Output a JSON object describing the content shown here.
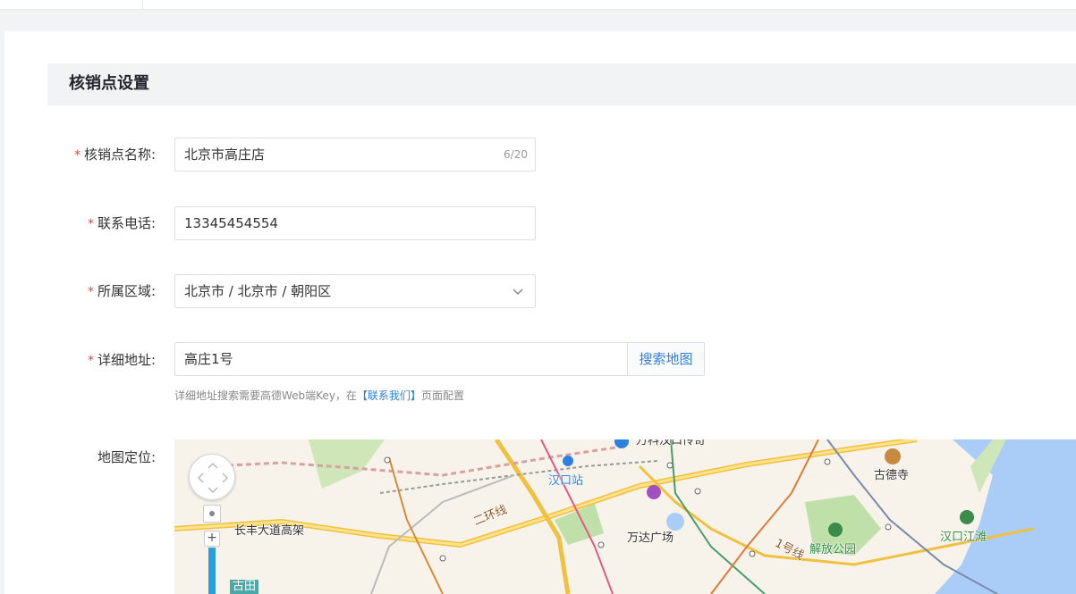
{
  "section": {
    "title": "核销点设置"
  },
  "form": {
    "required_mark": "*",
    "name": {
      "label": "核销点名称:",
      "value": "北京市高庄店",
      "counter": "6/20"
    },
    "phone": {
      "label": "联系电话:",
      "value": "13345454554"
    },
    "region": {
      "label": "所属区域:",
      "value": "北京市 / 北京市 / 朝阳区"
    },
    "address": {
      "label": "详细地址:",
      "value": "高庄1号",
      "search_label": "搜索地图"
    },
    "hint": {
      "prefix": "详细地址搜索需要高德Web端Key，在",
      "link": "【联系我们】",
      "suffix": "页面配置"
    },
    "map": {
      "label": "地图定位:"
    }
  },
  "map_labels": {
    "hankou_station": "汉口站",
    "wanke": "万科汉口传奇",
    "gude_temple": "古德寺",
    "wanda": "万达广场",
    "jiefang_park": "解放公园",
    "hankou_riverside": "汉口江滩",
    "changfeng": "长丰大道高架",
    "ring_road": "二环线",
    "line1": "1号线",
    "gutian": "古田"
  },
  "colors": {
    "required": "#ee4433",
    "link": "#2d7fe0",
    "zoom_bar": "#2b9fd9"
  },
  "icons": {
    "select_arrow": "chevron-down-icon",
    "zoom_pan": "pan-control-icon",
    "zoom_in": "plus-icon"
  }
}
